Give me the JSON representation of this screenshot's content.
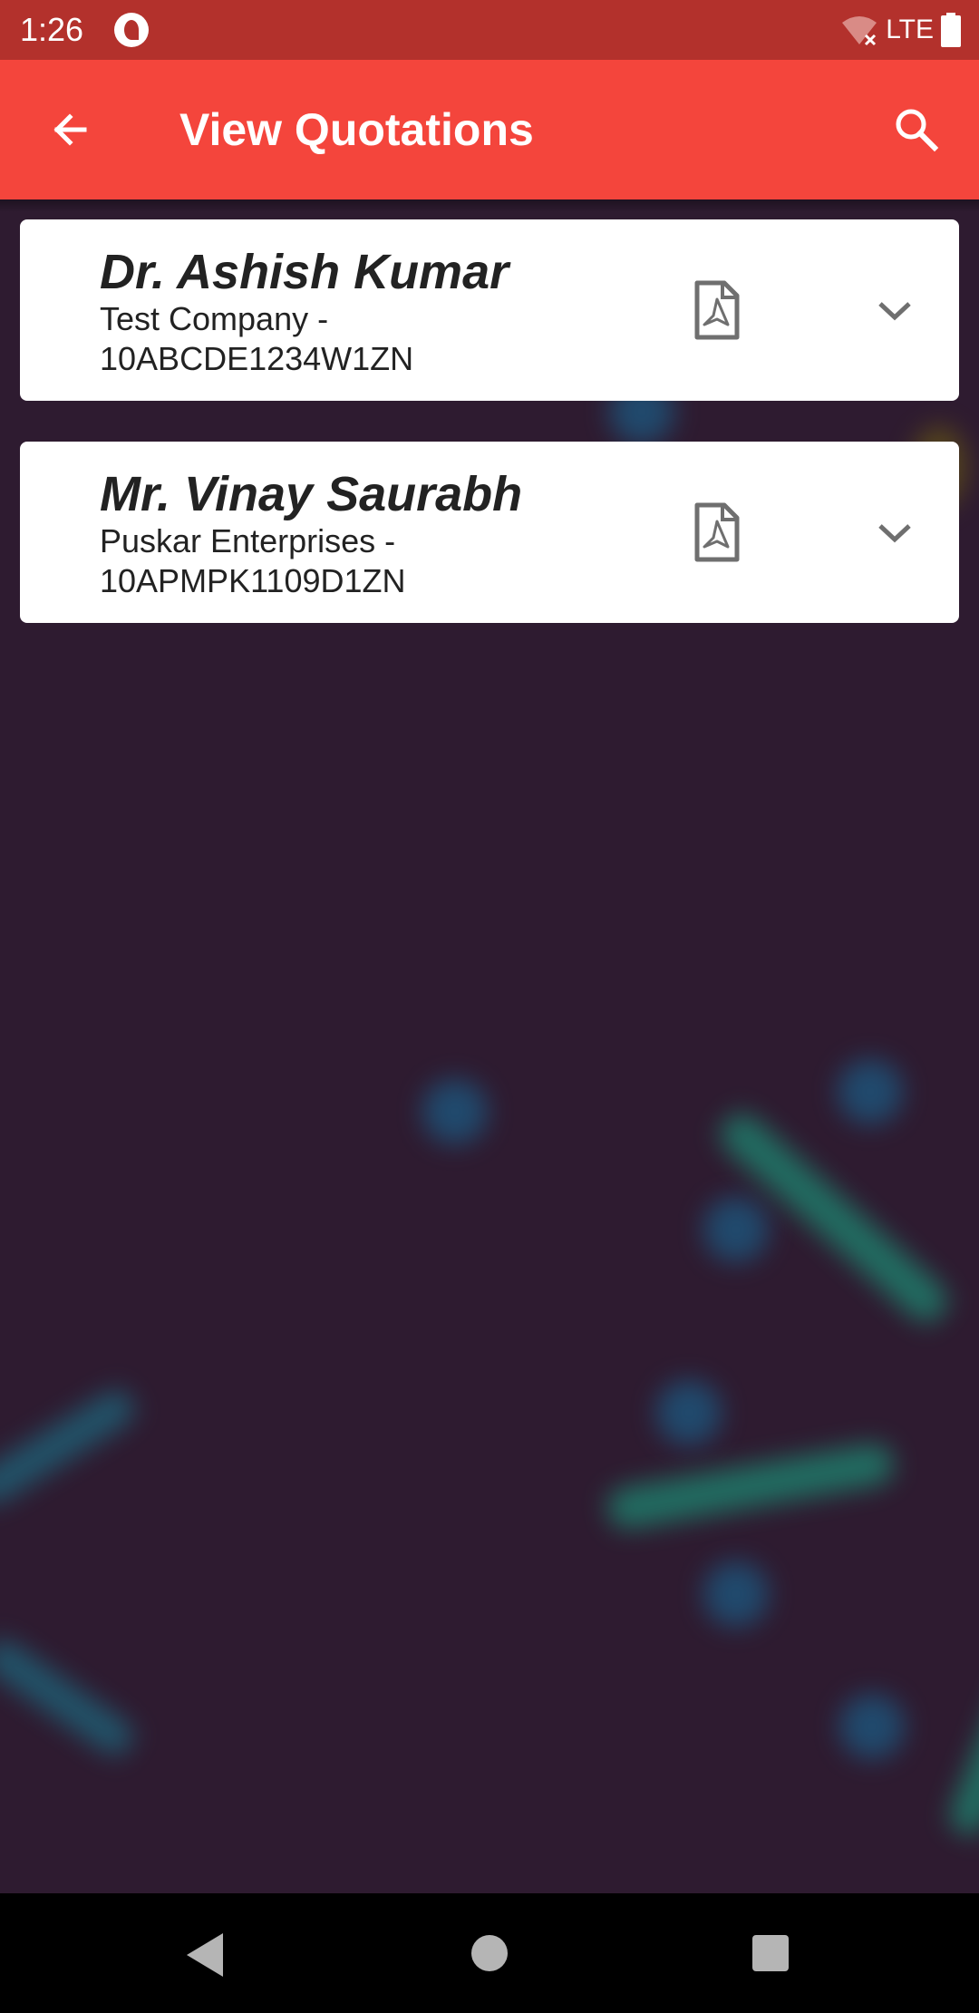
{
  "status_bar": {
    "time": "1:26",
    "network": "LTE",
    "icons": [
      "app-notification-icon",
      "wifi-off-icon",
      "battery-icon"
    ]
  },
  "app_bar": {
    "title": "View Quotations",
    "back_icon": "arrow-back-icon",
    "search_icon": "search-icon",
    "color": "#f4453c"
  },
  "quotations": [
    {
      "name": "Dr. Ashish Kumar",
      "company_line1": "Test Company -",
      "company_line2": "10ABCDE1234W1ZN",
      "pdf_icon": "pdf-file-icon",
      "expand_icon": "chevron-down-icon"
    },
    {
      "name": "Mr. Vinay Saurabh",
      "company_line1": "Puskar Enterprises -",
      "company_line2": "10APMPK1109D1ZN",
      "pdf_icon": "pdf-file-icon",
      "expand_icon": "chevron-down-icon"
    }
  ],
  "nav_bar": {
    "icons": [
      "nav-back-icon",
      "nav-home-icon",
      "nav-recents-icon"
    ]
  },
  "colors": {
    "status_bar": "#b3312c",
    "background": "#2e1b30",
    "card": "#ffffff",
    "icon_gray": "#6f6f6f"
  }
}
